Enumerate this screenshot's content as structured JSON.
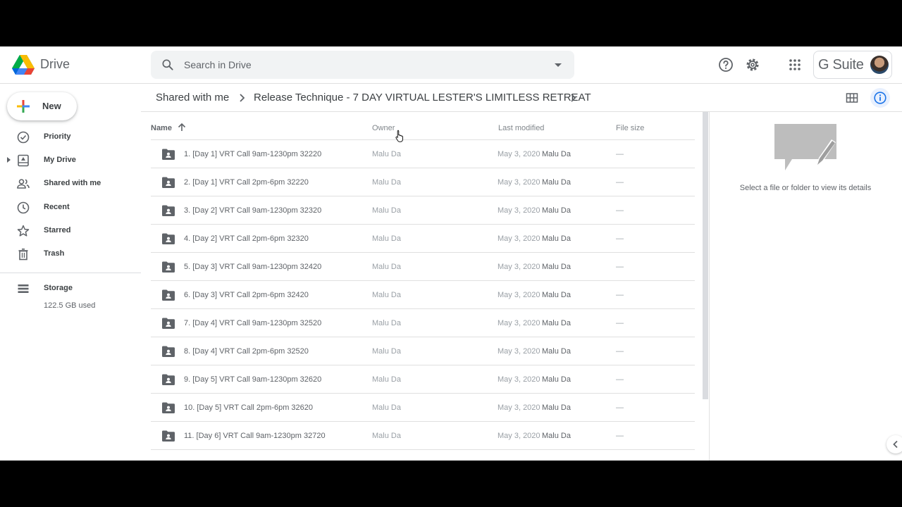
{
  "app": {
    "title": "Drive"
  },
  "search": {
    "placeholder": "Search in Drive"
  },
  "header": {
    "gsuite_label": "G Suite"
  },
  "sidebar": {
    "new_label": "New",
    "items": [
      {
        "label": "Priority",
        "icon": "checkbox-icon"
      },
      {
        "label": "My Drive",
        "icon": "my-drive-icon"
      },
      {
        "label": "Shared with me",
        "icon": "people-icon"
      },
      {
        "label": "Recent",
        "icon": "clock-icon"
      },
      {
        "label": "Starred",
        "icon": "star-icon"
      },
      {
        "label": "Trash",
        "icon": "trash-icon"
      }
    ],
    "storage": {
      "label": "Storage",
      "used": "122.5 GB used"
    }
  },
  "breadcrumb": {
    "items": [
      "Shared with me",
      "Release Technique - 7 DAY VIRTUAL LESTER'S LIMITLESS RETREAT"
    ]
  },
  "list": {
    "columns": {
      "name": "Name",
      "owner": "Owner",
      "modified": "Last modified",
      "size": "File size"
    },
    "rows": [
      {
        "name": "1. [Day 1] VRT Call 9am-1230pm 32220",
        "owner": "Malu Da",
        "date": "May 3, 2020",
        "by": "Malu Da",
        "size": "—"
      },
      {
        "name": "2. [Day 1] VRT Call 2pm-6pm 32220",
        "owner": "Malu Da",
        "date": "May 3, 2020",
        "by": "Malu Da",
        "size": "—"
      },
      {
        "name": "3. [Day 2] VRT Call 9am-1230pm 32320",
        "owner": "Malu Da",
        "date": "May 3, 2020",
        "by": "Malu Da",
        "size": "—"
      },
      {
        "name": "4. [Day 2] VRT Call 2pm-6pm 32320",
        "owner": "Malu Da",
        "date": "May 3, 2020",
        "by": "Malu Da",
        "size": "—"
      },
      {
        "name": "5. [Day 3] VRT Call 9am-1230pm 32420",
        "owner": "Malu Da",
        "date": "May 3, 2020",
        "by": "Malu Da",
        "size": "—"
      },
      {
        "name": "6. [Day 3] VRT Call 2pm-6pm 32420",
        "owner": "Malu Da",
        "date": "May 3, 2020",
        "by": "Malu Da",
        "size": "—"
      },
      {
        "name": "7. [Day 4] VRT Call 9am-1230pm 32520",
        "owner": "Malu Da",
        "date": "May 3, 2020",
        "by": "Malu Da",
        "size": "—"
      },
      {
        "name": "8. [Day 4] VRT Call 2pm-6pm 32520",
        "owner": "Malu Da",
        "date": "May 3, 2020",
        "by": "Malu Da",
        "size": "—"
      },
      {
        "name": "9. [Day 5] VRT Call 9am-1230pm 32620",
        "owner": "Malu Da",
        "date": "May 3, 2020",
        "by": "Malu Da",
        "size": "—"
      },
      {
        "name": "10. [Day 5] VRT Call 2pm-6pm 32620",
        "owner": "Malu Da",
        "date": "May 3, 2020",
        "by": "Malu Da",
        "size": "—"
      },
      {
        "name": "11. [Day 6] VRT Call 9am-1230pm 32720",
        "owner": "Malu Da",
        "date": "May 3, 2020",
        "by": "Malu Da",
        "size": "—"
      }
    ]
  },
  "details": {
    "empty_text": "Select a file or folder to view its details"
  },
  "colors": {
    "accent": "#1a73e8",
    "folder": "#5f6368",
    "selected_bg": "#e8f0fe"
  }
}
